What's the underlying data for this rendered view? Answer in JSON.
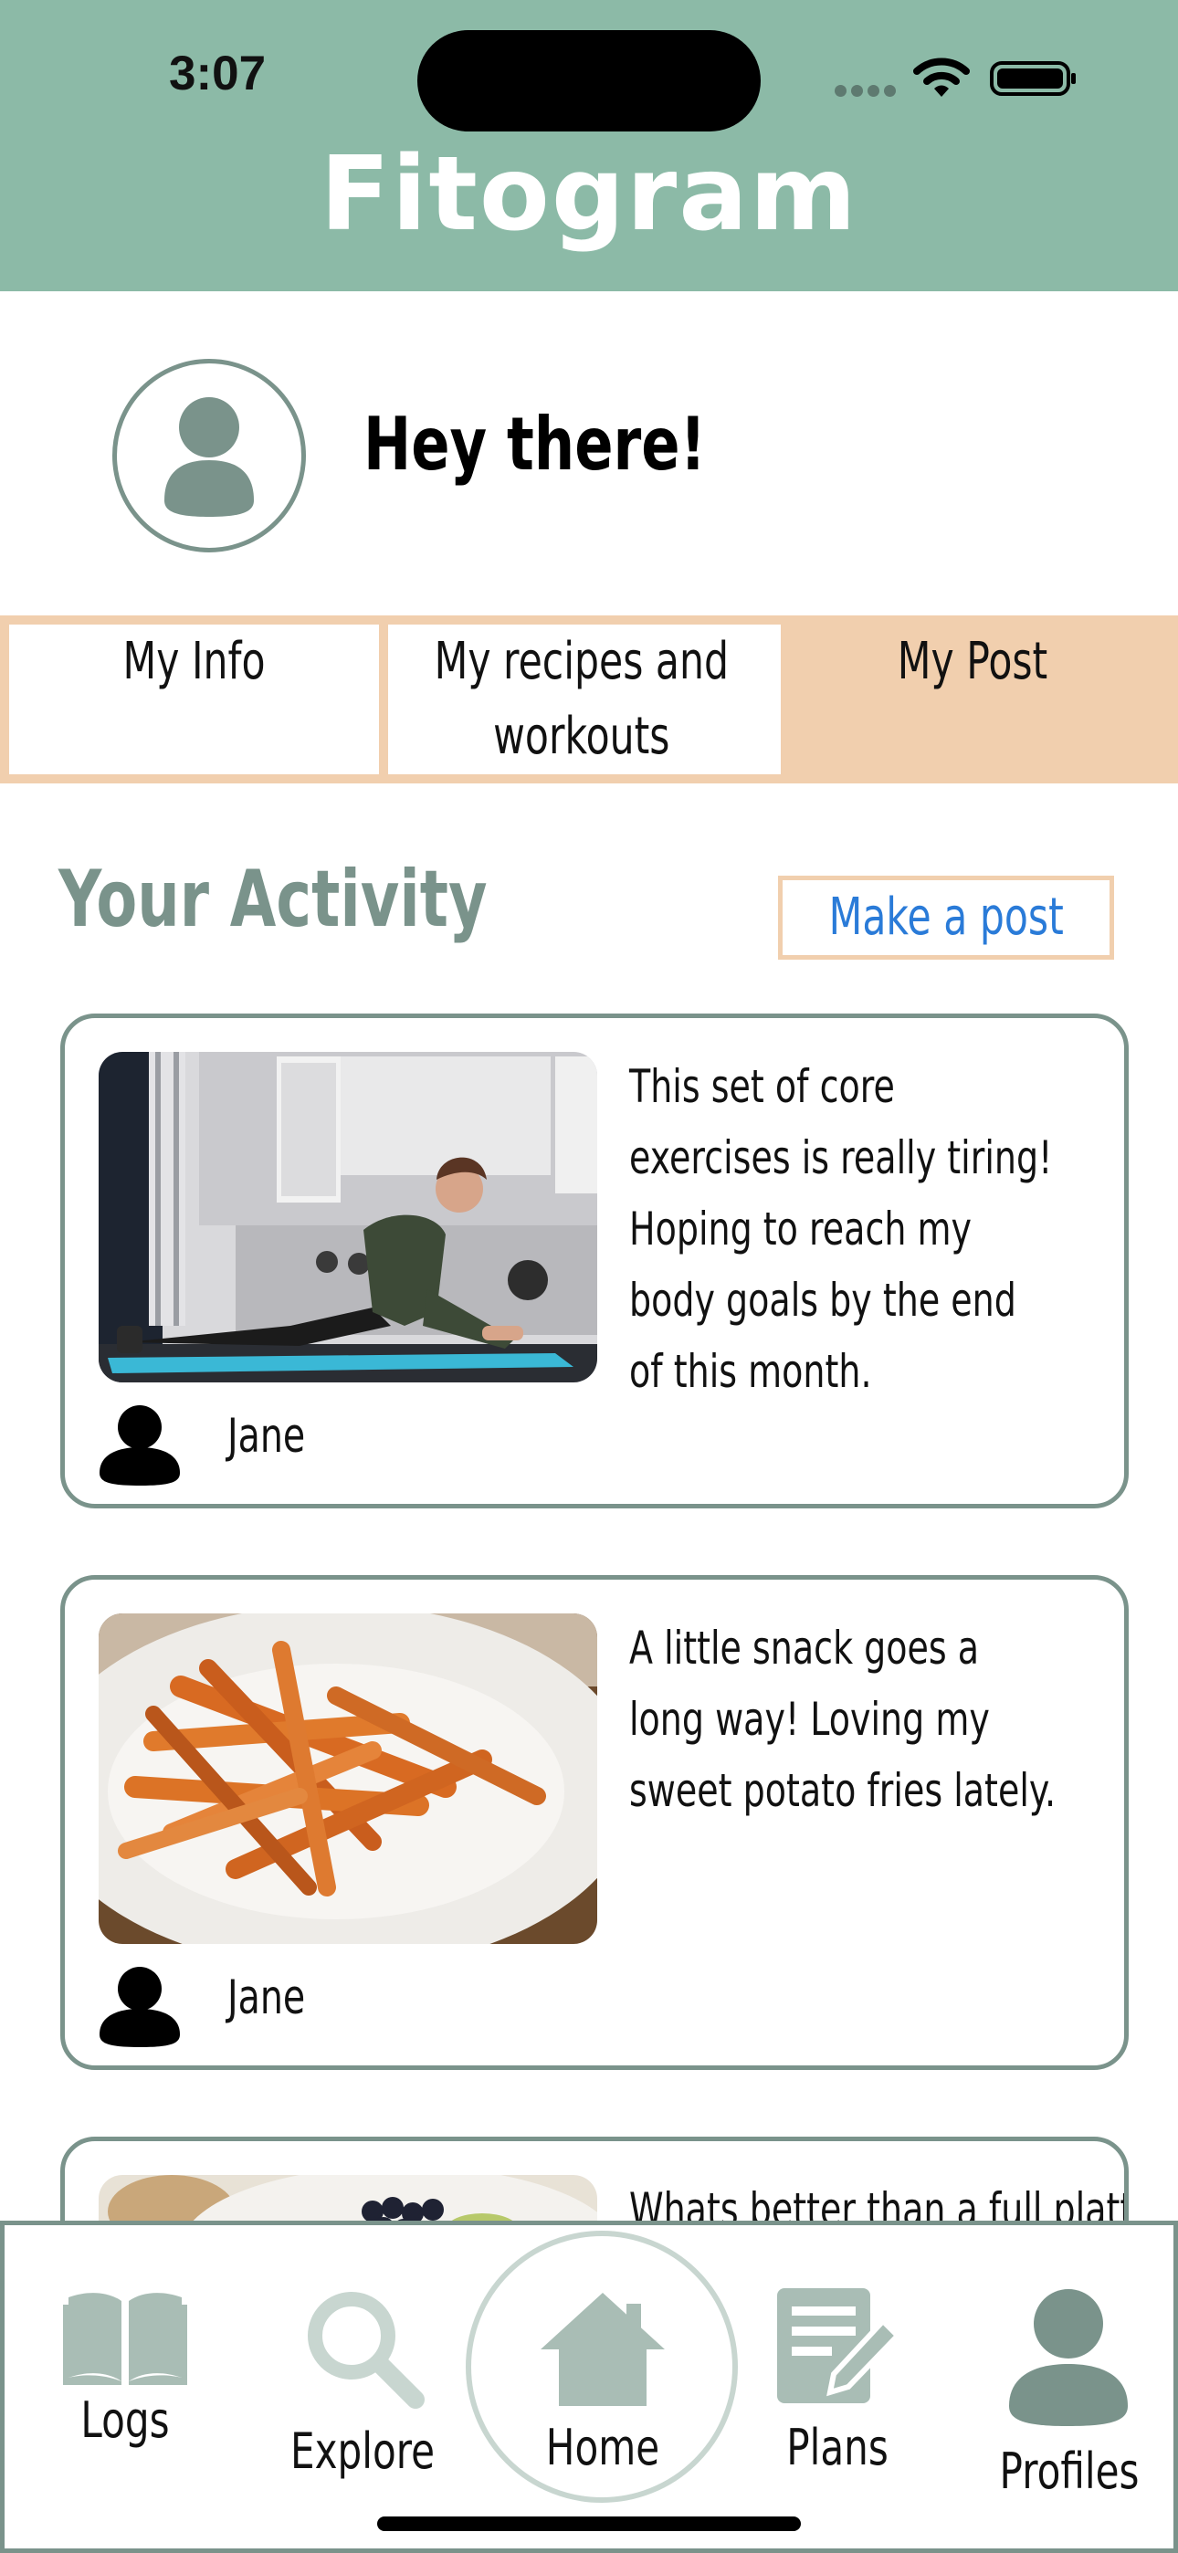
{
  "status_bar": {
    "time": "3:07"
  },
  "app": {
    "title": "Fitogram"
  },
  "greeting": {
    "text": "Hey there!"
  },
  "tabs": [
    {
      "label": "My Info",
      "active": false
    },
    {
      "label": "My recipes and workouts",
      "active": false
    },
    {
      "label": "My Post",
      "active": true
    }
  ],
  "activity": {
    "title": "Your Activity",
    "make_post_label": "Make a post"
  },
  "posts": [
    {
      "image": "woman-doing-plank-on-yoga-mat",
      "text": "This set of core exercises is really tiring! Hoping to reach my body goals by the end of this month.",
      "author": "Jane"
    },
    {
      "image": "sweet-potato-fries-on-plate",
      "text": "A little snack goes a long way! Loving my sweet potato fries lately.",
      "author": "Jane"
    },
    {
      "image": "food-platter-with-berries",
      "text": "Whats better than a full platter",
      "author": ""
    }
  ],
  "bottom_nav": {
    "items": [
      {
        "label": "Logs",
        "icon": "book-icon"
      },
      {
        "label": "Explore",
        "icon": "search-icon"
      },
      {
        "label": "Home",
        "icon": "home-icon"
      },
      {
        "label": "Plans",
        "icon": "notepad-pencil-icon"
      },
      {
        "label": "Profiles",
        "icon": "person-icon"
      }
    ]
  },
  "colors": {
    "header": "#8cbaa7",
    "accent_peach": "#f1cfae",
    "muted_green": "#7a938b",
    "link_blue": "#2a7bd8",
    "nav_icon_light": "#c8d6d0"
  }
}
